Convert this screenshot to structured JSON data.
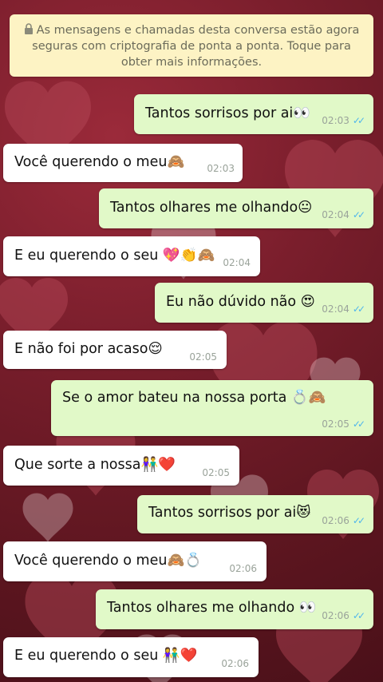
{
  "notice": {
    "text": "As mensagens e chamadas desta conversa estão agora seguras com criptografia de ponta a ponta. Toque para obter mais informações."
  },
  "messages": [
    {
      "text": "Tantos sorrisos por ai👀",
      "time": "02:03",
      "direction": "out"
    },
    {
      "text": "Você querendo o meu🙈",
      "time": "02:03",
      "direction": "in"
    },
    {
      "text": "Tantos olhares me olhando😐",
      "time": "02:04",
      "direction": "out"
    },
    {
      "text": "E eu querendo o seu 💖👏🙈",
      "time": "02:04",
      "direction": "in"
    },
    {
      "text": "Eu não dúvido não 😍",
      "time": "02:04",
      "direction": "out"
    },
    {
      "text": "E não foi por acaso😌",
      "time": "02:05",
      "direction": "in"
    },
    {
      "text": "Se o amor bateu na nossa porta 💍🙈",
      "time": "02:05",
      "direction": "out"
    },
    {
      "text": "Que sorte a nossa👫❤️",
      "time": "02:05",
      "direction": "in"
    },
    {
      "text": "Tantos sorrisos por ai😻",
      "time": "02:06",
      "direction": "out"
    },
    {
      "text": "Você querendo o meu🙈💍",
      "time": "02:06",
      "direction": "in"
    },
    {
      "text": "Tantos olhares me olhando 👀",
      "time": "02:06",
      "direction": "out"
    },
    {
      "text": "E eu querendo o seu 👫❤️",
      "time": "02:06",
      "direction": "in"
    }
  ],
  "colors": {
    "outgoing_bubble": "#e1f9c8",
    "incoming_bubble": "#ffffff",
    "notice_bubble": "#fdf3c4",
    "read_ticks": "#4fb6ec"
  },
  "icons": {
    "notice": "lock-icon",
    "status": "double-check-icon"
  }
}
